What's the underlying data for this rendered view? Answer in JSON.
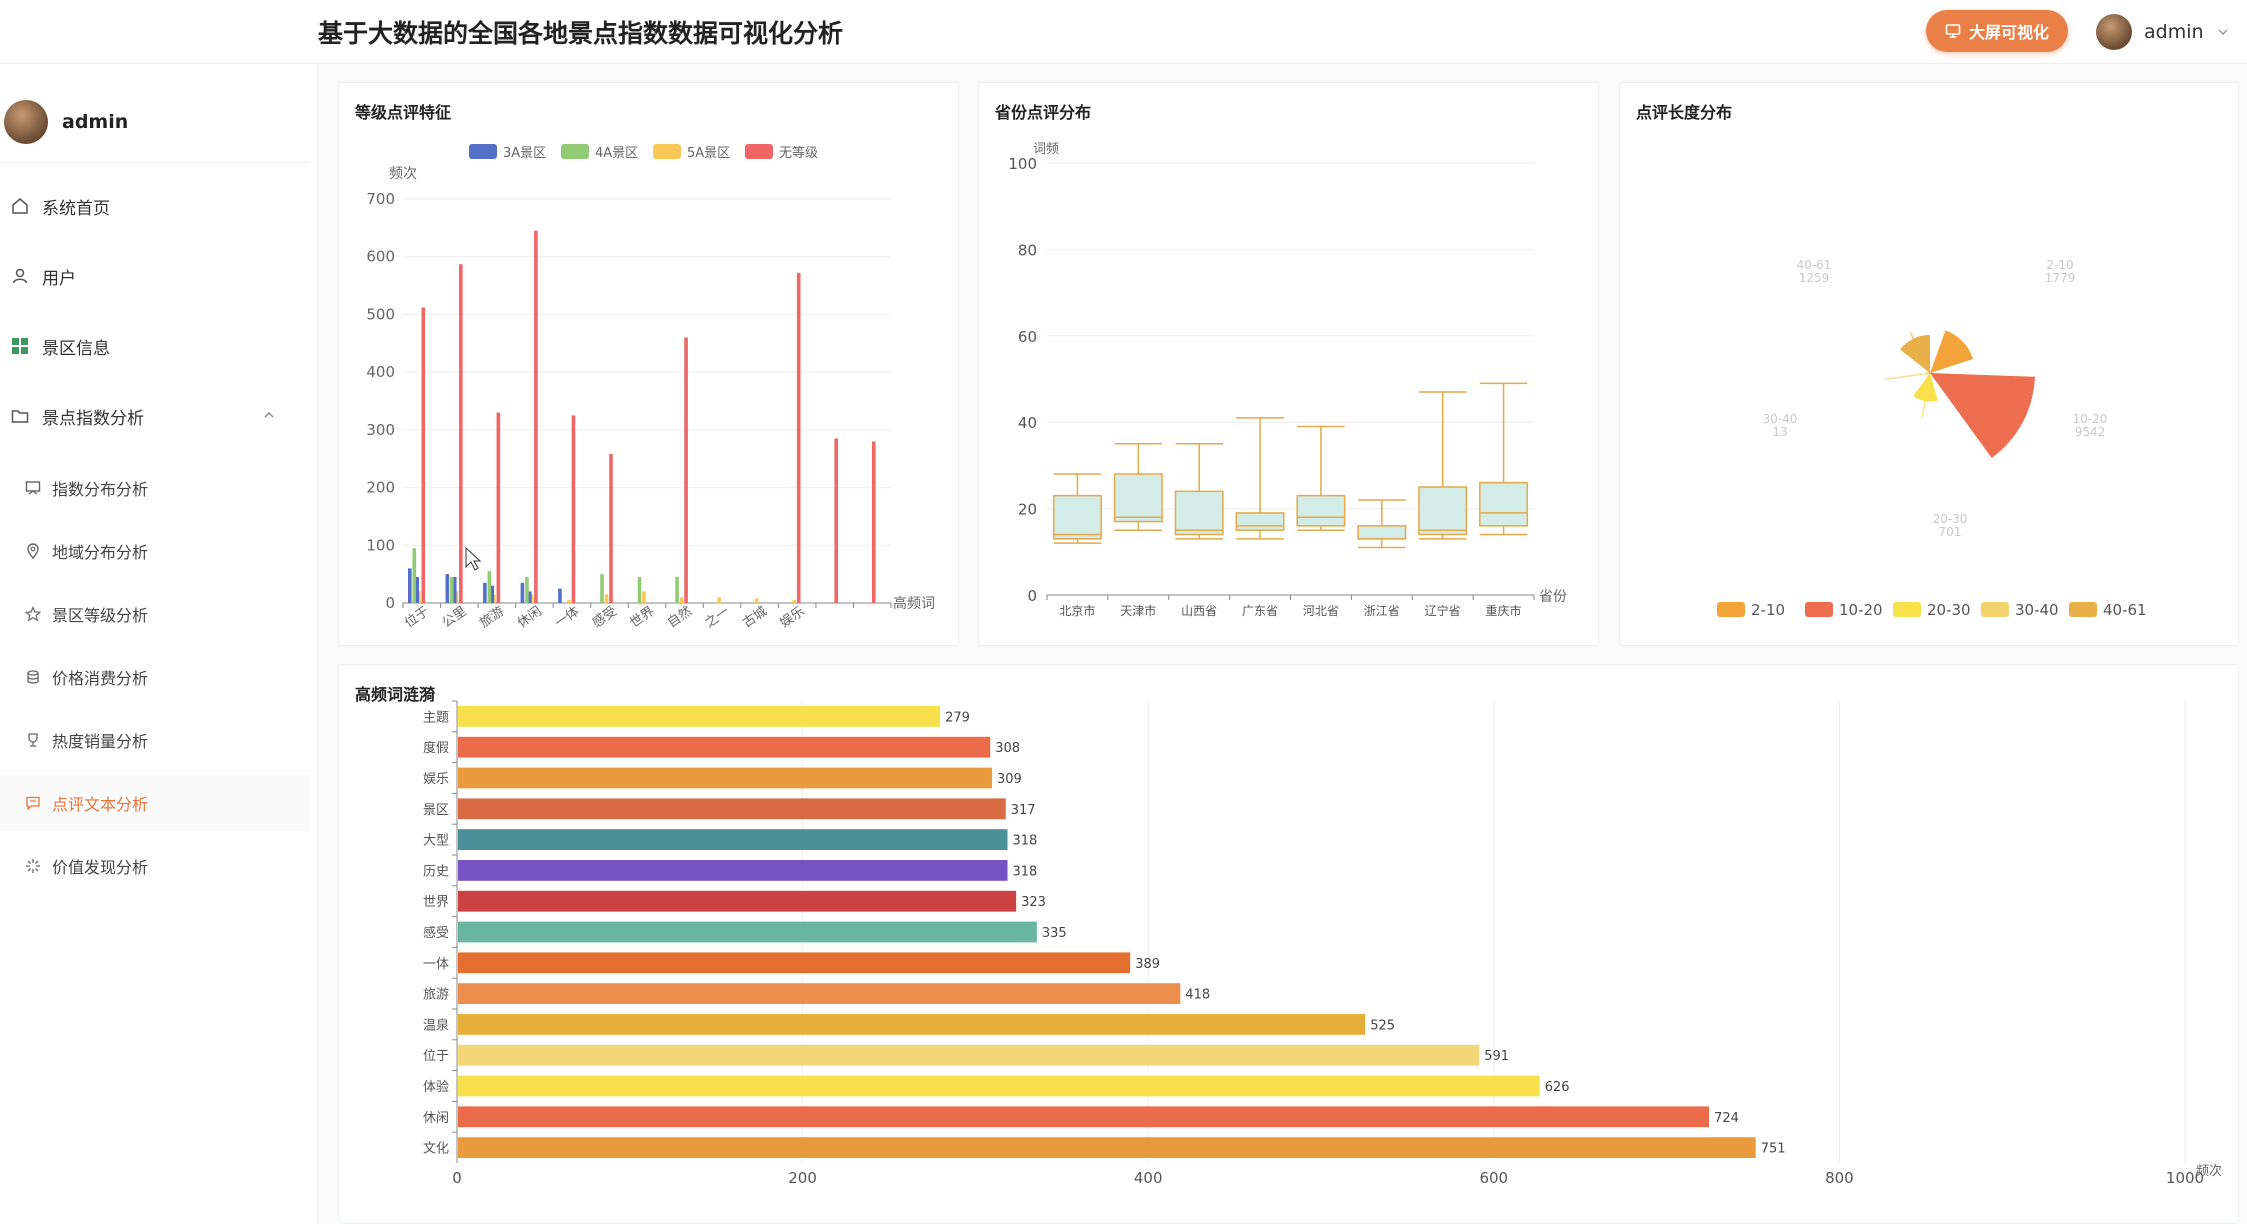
{
  "header": {
    "title": "基于大数据的全国各地景点指数数据可视化分析",
    "big_screen_label": "大屏可视化",
    "username": "admin"
  },
  "sidebar": {
    "username": "admin",
    "items": [
      {
        "label": "系统首页",
        "icon": "home-icon"
      },
      {
        "label": "用户",
        "icon": "user-icon"
      },
      {
        "label": "景区信息",
        "icon": "grid-icon"
      },
      {
        "label": "景点指数分析",
        "icon": "folder-icon",
        "expanded": true
      }
    ],
    "subitems": [
      {
        "label": "指数分布分析",
        "icon": "chart-icon"
      },
      {
        "label": "地域分布分析",
        "icon": "location-icon"
      },
      {
        "label": "景区等级分析",
        "icon": "star-icon"
      },
      {
        "label": "价格消费分析",
        "icon": "coins-icon"
      },
      {
        "label": "热度销量分析",
        "icon": "trophy-icon"
      },
      {
        "label": "点评文本分析",
        "icon": "comment-icon",
        "active": true
      },
      {
        "label": "价值发现分析",
        "icon": "sparkle-icon"
      }
    ]
  },
  "charts": {
    "grade": {
      "title": "等级点评特征"
    },
    "province": {
      "title": "省份点评分布"
    },
    "length": {
      "title": "点评长度分布"
    },
    "words": {
      "title": "高频词涟漪"
    }
  },
  "chart_data": [
    {
      "type": "bar",
      "title": "等级点评特征",
      "ylabel": "频次",
      "xlabel": "高频词",
      "ylim": [
        0,
        700
      ],
      "yticks": [
        0,
        100,
        200,
        300,
        400,
        500,
        600,
        700
      ],
      "legend_position": "top",
      "categories": [
        "位于",
        "公里",
        "旅游",
        "休闲",
        "一体",
        "感受",
        "世界",
        "自然",
        "之一",
        "古城",
        "娱乐",
        "",
        ""
      ],
      "tick_labels": [
        "位于",
        "公里",
        "旅游",
        "休闲",
        "一体",
        "感受",
        "世界",
        "自然",
        "之一",
        "古城",
        "娱乐"
      ],
      "series": [
        {
          "name": "3A景区",
          "color": "#5470c6",
          "values": [
            60,
            50,
            35,
            35,
            25,
            0,
            0,
            0,
            0,
            0,
            0,
            0,
            0
          ]
        },
        {
          "name": "4A景区",
          "color": "#91cc75",
          "values": [
            95,
            45,
            55,
            45,
            0,
            50,
            45,
            45,
            0,
            0,
            0,
            0,
            0
          ]
        },
        {
          "name": "5A景区",
          "color": "#fac858",
          "values": [
            20,
            20,
            15,
            15,
            5,
            15,
            20,
            10,
            10,
            8,
            5,
            0,
            0
          ]
        },
        {
          "name": "无等级",
          "color": "#ee6666",
          "values": [
            512,
            587,
            330,
            645,
            325,
            258,
            0,
            460,
            0,
            0,
            572,
            285,
            280
          ]
        }
      ],
      "extra_3a": [
        45,
        45,
        30,
        20,
        0,
        0,
        0,
        0,
        0,
        0,
        0,
        0,
        0
      ]
    },
    {
      "type": "boxplot",
      "title": "省份点评分布",
      "ylabel": "词频",
      "xlabel": "省份",
      "ylim": [
        0,
        100
      ],
      "yticks": [
        0,
        20,
        40,
        60,
        80,
        100
      ],
      "categories": [
        "北京市",
        "天津市",
        "山西省",
        "广东省",
        "河北省",
        "浙江省",
        "辽宁省",
        "重庆市"
      ],
      "boxes": [
        [
          12,
          13,
          14,
          23,
          28
        ],
        [
          15,
          17,
          18,
          28,
          35
        ],
        [
          13,
          14,
          15,
          24,
          35
        ],
        [
          13,
          15,
          16,
          19,
          41
        ],
        [
          15,
          16,
          18,
          23,
          39
        ],
        [
          11,
          13,
          13,
          16,
          22
        ],
        [
          13,
          14,
          15,
          25,
          47
        ],
        [
          14,
          16,
          19,
          26,
          49
        ]
      ]
    },
    {
      "type": "pie",
      "title": "点评长度分布",
      "rose": true,
      "legend_position": "bottom",
      "slices": [
        {
          "label": "2-10",
          "value": 1779,
          "color": "#f2a33a"
        },
        {
          "label": "10-20",
          "value": 9542,
          "color": "#ec6e4f"
        },
        {
          "label": "20-30",
          "value": 701,
          "color": "#f8e14a"
        },
        {
          "label": "30-40",
          "value": 13,
          "color": "#f3d36d"
        },
        {
          "label": "40-61",
          "value": 1259,
          "color": "#e9b04a"
        }
      ]
    },
    {
      "type": "bar",
      "orientation": "horizontal",
      "title": "高频词涟漪",
      "xlabel": "频次",
      "xlim": [
        0,
        1000
      ],
      "xticks": [
        0,
        200,
        400,
        600,
        800,
        1000
      ],
      "categories": [
        "主题",
        "度假",
        "娱乐",
        "景区",
        "大型",
        "历史",
        "世界",
        "感受",
        "一体",
        "旅游",
        "温泉",
        "位于",
        "体验",
        "休闲",
        "文化"
      ],
      "values": [
        279,
        308,
        309,
        317,
        318,
        318,
        323,
        335,
        389,
        418,
        525,
        591,
        626,
        724,
        751
      ],
      "colors": [
        "#f7e04c",
        "#eb6c4b",
        "#e89a3c",
        "#d96b45",
        "#4a8f9a",
        "#7653c4",
        "#cc4141",
        "#68b6a0",
        "#e36e30",
        "#ec8e4d",
        "#e5af3a",
        "#f3d676",
        "#f7e04c",
        "#eb6c4b",
        "#e89a3c"
      ]
    }
  ]
}
